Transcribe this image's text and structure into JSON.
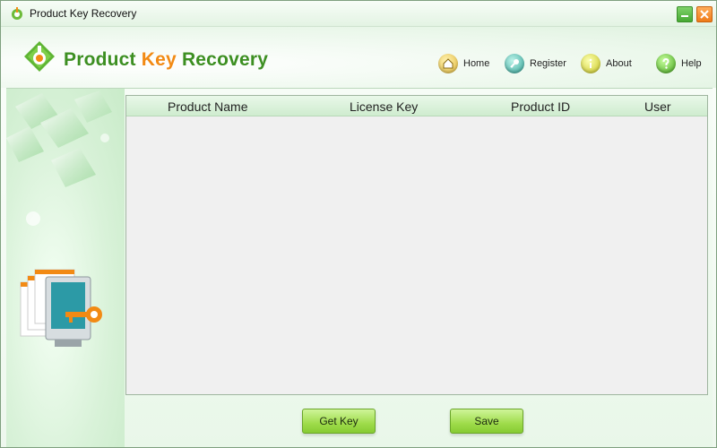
{
  "window": {
    "title": "Product Key Recovery",
    "minimize_label": "—",
    "close_label": "✕"
  },
  "header": {
    "app_title_part1": "Product ",
    "app_title_part2": "Key",
    "app_title_part3": " Recovery",
    "nav": {
      "home": "Home",
      "register": "Register",
      "about": "About",
      "help": "Help"
    }
  },
  "table": {
    "columns": [
      "Product Name",
      "License Key",
      "Product ID",
      "User"
    ],
    "rows": []
  },
  "buttons": {
    "get_key": "Get Key",
    "save": "Save"
  },
  "colors": {
    "brand_green": "#3d8f22",
    "brand_orange": "#f28a14",
    "button_green": "#9fdc4b"
  },
  "icons": {
    "home": "house-icon",
    "register": "key-icon",
    "about": "info-icon",
    "help": "question-icon"
  }
}
